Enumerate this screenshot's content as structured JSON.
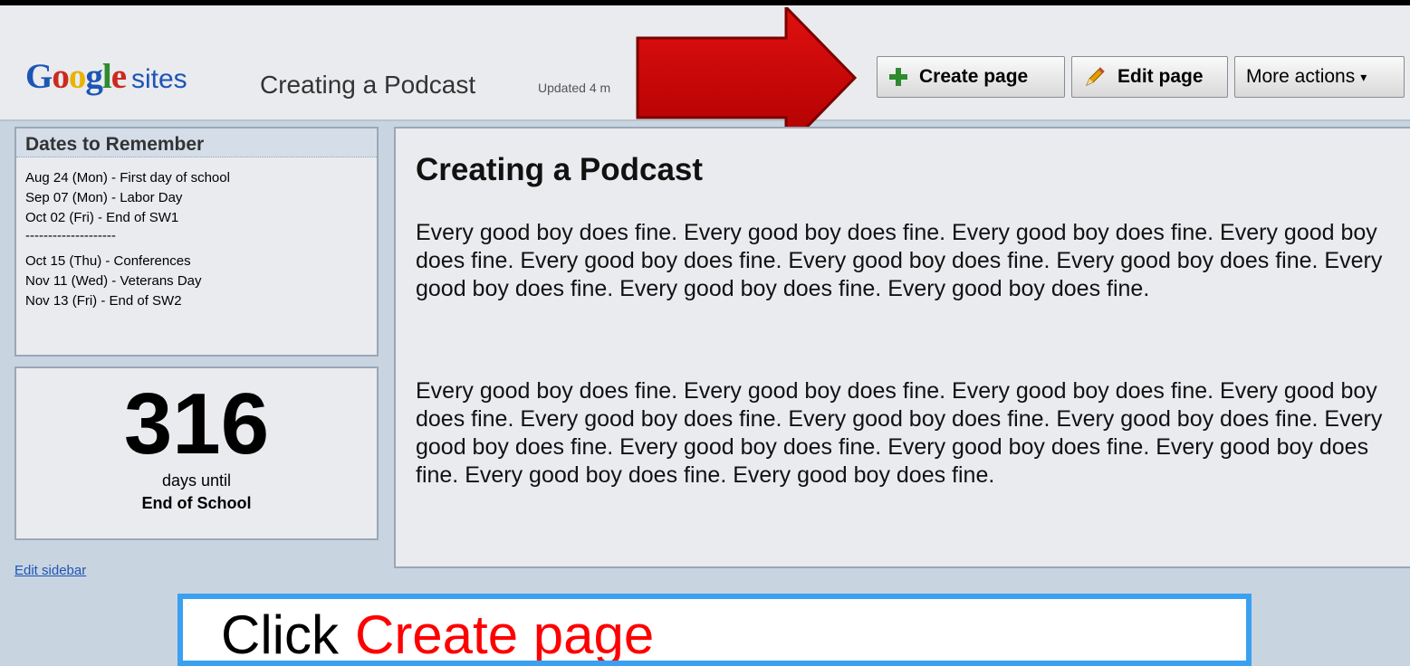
{
  "header": {
    "logo_google": "Google",
    "logo_sites": "sites",
    "site_title": "Creating a Podcast",
    "updated_text": "Updated 4 m"
  },
  "toolbar": {
    "create_label": "Create page",
    "edit_label": "Edit page",
    "more_label": "More actions",
    "more_caret": "▾"
  },
  "sidebar": {
    "dates_title": "Dates to Remember",
    "dates": [
      "Aug 24 (Mon) - First day of school",
      "Sep 07 (Mon) - Labor Day",
      "Oct 02 (Fri) - End of SW1",
      "--------------------",
      "Oct 15 (Thu) - Conferences",
      "Nov 11 (Wed) - Veterans Day",
      "Nov 13 (Fri) - End of SW2"
    ],
    "countdown_number": "316",
    "countdown_label": "days until",
    "countdown_target": "End of School",
    "edit_link": "Edit sidebar"
  },
  "main": {
    "title": "Creating a Podcast",
    "paragraphs": [
      "Every good boy does fine.  Every good boy does fine.  Every good boy does fine.  Every good boy does fine.  Every good boy does fine.  Every good boy does fine.  Every good boy does fine.  Every good boy does fine.  Every good boy does fine.  Every good boy does fine.",
      "Every good boy does fine.  Every good boy does fine.  Every good boy does fine.  Every good boy does fine.  Every good boy does fine.  Every good boy does fine.  Every good boy does fine.  Every good boy does fine.  Every good boy does fine.  Every good boy does fine.  Every good boy does fine.  Every good boy does fine.  Every good boy does fine."
    ]
  },
  "callout": {
    "command": "Click",
    "target": "Create page"
  },
  "colors": {
    "arrow": "#cc0000",
    "callout_border": "#3aa0f0",
    "callout_target": "#ff0000",
    "link": "#1d55b5"
  },
  "icons": {
    "create": "plus-icon",
    "edit": "pencil-icon",
    "more": "chevron-down-icon",
    "pointer": "red-arrow-icon"
  }
}
